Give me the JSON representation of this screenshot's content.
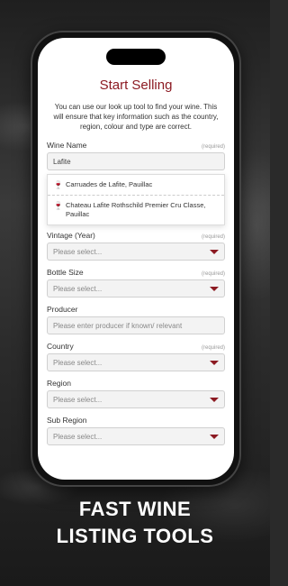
{
  "app": {
    "title": "Start Selling",
    "intro": "You can use our look up tool to find your wine. This will ensure that key information such as the country, region, colour and type are correct."
  },
  "form": {
    "wine_name": {
      "label": "Wine Name",
      "required": "(required)",
      "value": "Lafite"
    },
    "suggestions": [
      "Carruades de Lafite, Pauillac",
      "Chateau Lafite Rothschild Premier Cru Classe, Pauillac"
    ],
    "vintage": {
      "label": "Vintage (Year)",
      "required": "(required)",
      "placeholder": "Please select..."
    },
    "bottle_size": {
      "label": "Bottle Size",
      "required": "(required)",
      "placeholder": "Please select..."
    },
    "producer": {
      "label": "Producer",
      "placeholder": "Please enter producer if known/ relevant"
    },
    "country": {
      "label": "Country",
      "required": "(required)",
      "placeholder": "Please select..."
    },
    "region": {
      "label": "Region",
      "placeholder": "Please select..."
    },
    "sub_region": {
      "label": "Sub Region",
      "placeholder": "Please select..."
    }
  },
  "footer": {
    "line1": "FAST WINE",
    "line2": "LISTING TOOLS"
  },
  "colors": {
    "accent": "#8c1a22"
  }
}
